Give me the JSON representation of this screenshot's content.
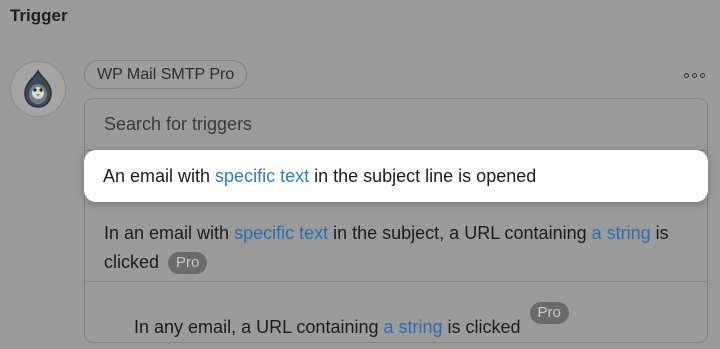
{
  "section_title": "Trigger",
  "plugin_chip": "WP Mail SMTP Pro",
  "search": {
    "placeholder": "Search for triggers"
  },
  "options": [
    {
      "before": "An email with ",
      "link": "specific text",
      "after": " in the subject line is opened"
    },
    {
      "before": "In an email with ",
      "link": "specific text",
      "middle": " in the subject, a URL containing ",
      "link2": "a string",
      "after": " is clicked ",
      "badge": "Pro"
    },
    {
      "before": "In any email, a URL containing ",
      "link": "a string",
      "after": " is clicked ",
      "badge": "Pro"
    }
  ],
  "icons": {
    "avatar": "wp-mail-smtp-bird-icon",
    "more": "more-options-icon"
  }
}
